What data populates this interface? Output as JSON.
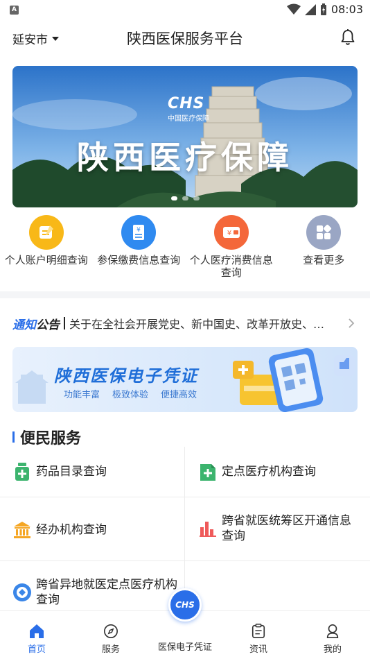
{
  "status_bar": {
    "app_badge": "A",
    "time": "08:03"
  },
  "header": {
    "city": "延安市",
    "title": "陕西医保服务平台"
  },
  "banner": {
    "logo_text": "CHS",
    "logo_sub": "中国医疗保障",
    "title": "陕西医疗保障",
    "dots": 3,
    "active_dot": 0
  },
  "quick_actions": [
    {
      "label": "个人账户明细查询",
      "icon": "account-detail-icon",
      "color": "#f8b818"
    },
    {
      "label": "参保缴费信息查询",
      "icon": "payment-info-icon",
      "color": "#2f8af0"
    },
    {
      "label": "个人医疗消费信息查询",
      "icon": "medical-consume-icon",
      "color": "#f4673a"
    },
    {
      "label": "查看更多",
      "icon": "more-grid-icon",
      "color": "#9aa6c4"
    }
  ],
  "notice": {
    "tag_a": "通知",
    "tag_b": "公告",
    "text": "关于在全社会开展党史、新中国史、改革开放史、社会主义发展史宣传教育的通知"
  },
  "ecard": {
    "title": "陕西医保电子凭证",
    "tags": [
      "功能丰富",
      "极致体验",
      "便捷高效"
    ]
  },
  "section": {
    "title": "便民服务"
  },
  "services": [
    {
      "label": "药品目录查询",
      "icon": "medicine-catalog-icon"
    },
    {
      "label": "定点医疗机构查询",
      "icon": "designated-hospital-icon"
    },
    {
      "label": "经办机构查询",
      "icon": "agency-building-icon"
    },
    {
      "label": "跨省就医统筹区开通信息查询",
      "icon": "bar-chart-icon"
    },
    {
      "label": "跨省异地就医定点医疗机构查询",
      "icon": "remote-hospital-icon"
    }
  ],
  "bottom_nav": {
    "home": "首页",
    "service": "服务",
    "center": "医保电子凭证",
    "center_logo": "CHS",
    "news": "资讯",
    "mine": "我的"
  },
  "colors": {
    "accent": "#2a6ee8"
  }
}
